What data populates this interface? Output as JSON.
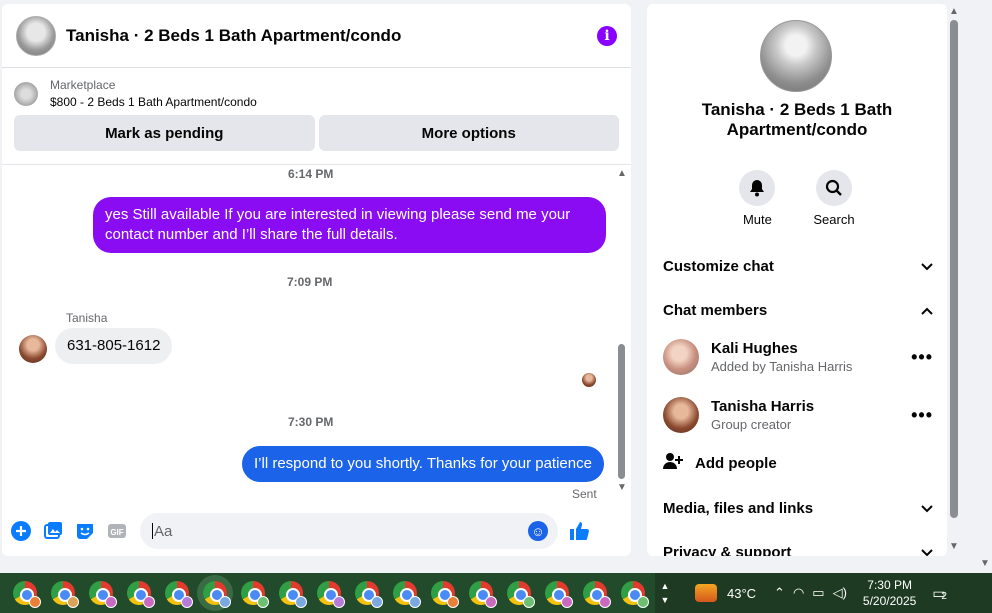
{
  "chat": {
    "title": "Tanisha · 2 Beds 1 Bath Apartment/condo",
    "marketplace_label": "Marketplace",
    "marketplace_item": "$800 - 2 Beds 1 Bath Apartment/condo",
    "mark_pending_label": "Mark as pending",
    "more_options_label": "More options",
    "messages": [
      {
        "timestamp": "6:14 PM"
      },
      {
        "text": "yes Still available If you are interested in viewing please send me your contact number and I’ll share the full details."
      },
      {
        "timestamp": "7:09 PM"
      },
      {
        "sender": "Tanisha",
        "text": "631-805-1612"
      },
      {
        "timestamp": "7:30 PM"
      },
      {
        "text": "I’ll respond to you shortly. Thanks for your patience",
        "status": "Sent"
      }
    ],
    "input_placeholder": "Aa"
  },
  "side": {
    "title_line1": "Tanisha · 2 Beds 1 Bath",
    "title_line2": "Apartment/condo",
    "mute_label": "Mute",
    "search_label": "Search",
    "customize_chat": "Customize chat",
    "chat_members": "Chat members",
    "members": [
      {
        "name": "Kali Hughes",
        "sub": "Added by Tanisha Harris"
      },
      {
        "name": "Tanisha Harris",
        "sub": "Group creator"
      }
    ],
    "add_people": "Add people",
    "media": "Media, files and links",
    "privacy": "Privacy & support"
  },
  "taskbar": {
    "temperature": "43°C",
    "time": "7:30 PM",
    "date": "5/20/2025",
    "notification_count": "2"
  },
  "colors": {
    "accent_purple": "#8a0cf2",
    "accent_blue": "#1b63e8",
    "messenger_blue": "#0a7cff"
  }
}
